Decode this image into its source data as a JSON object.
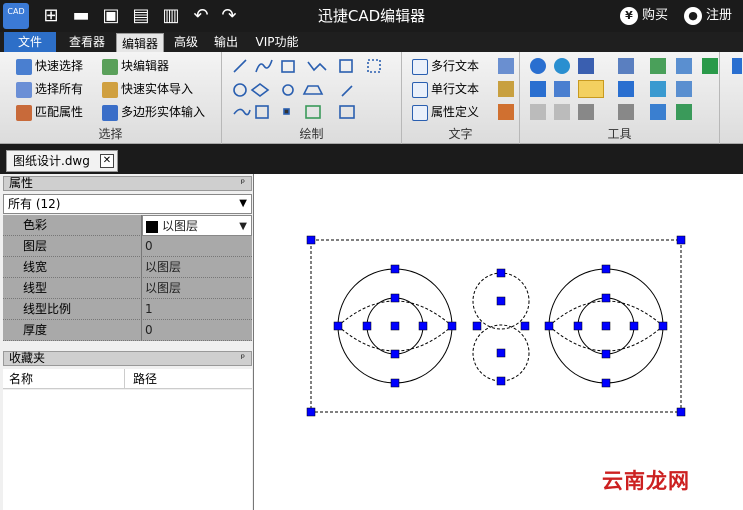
{
  "app": {
    "title": "迅捷CAD编辑器",
    "logo_text": "CAD",
    "buy_label": "购买",
    "register_label": "注册"
  },
  "menu": {
    "file": "文件",
    "tabs": [
      "查看器",
      "编辑器",
      "高级",
      "输出",
      "VIP功能"
    ],
    "active_tab": "编辑器"
  },
  "ribbon": {
    "select_group": {
      "label": "选择",
      "quick_select": "快速选择",
      "block_editor": "块编辑器",
      "select_all": "选择所有",
      "quick_entity_import": "快速实体导入",
      "match_properties": "匹配属性",
      "polygon_entity_input": "多边形实体输入"
    },
    "draw_group": {
      "label": "绘制"
    },
    "text_group": {
      "label": "文字",
      "multiline_text": "多行文本",
      "single_text": "单行文本",
      "attribute_define": "属性定义"
    },
    "tools_group": {
      "label": "工具"
    }
  },
  "document": {
    "tab_label": "图纸设计.dwg",
    "close_glyph": "✕"
  },
  "properties": {
    "header": "属性",
    "pin_glyph": "ᵖ",
    "filter": "所有 (12)",
    "rows": [
      {
        "name": "色彩",
        "value": "以图层"
      },
      {
        "name": "图层",
        "value": "0"
      },
      {
        "name": "线宽",
        "value": "以图层"
      },
      {
        "name": "线型",
        "value": "以图层"
      },
      {
        "name": "线型比例",
        "value": "1"
      },
      {
        "name": "厚度",
        "value": "0"
      }
    ]
  },
  "favorites": {
    "header": "收藏夹",
    "col_name": "名称",
    "col_path": "路径"
  },
  "watermark": "云南龙网",
  "colors": {
    "titlebar": "#1b1b1b",
    "accent": "#2d6fc8",
    "grip": "#0000ff"
  }
}
